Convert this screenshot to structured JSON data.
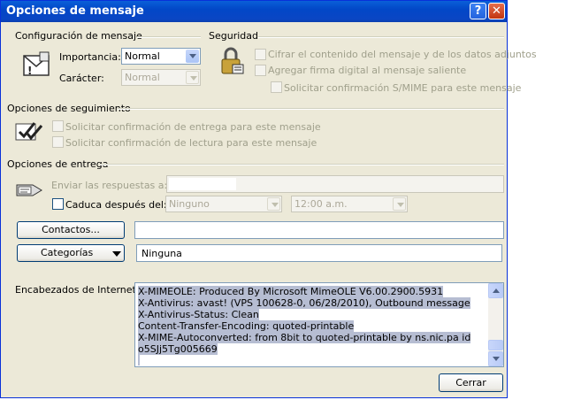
{
  "window": {
    "title": "Opciones de mensaje",
    "help_label": "?",
    "close_label": "✕"
  },
  "config": {
    "section_label": "Configuración de mensaje",
    "importance_label": "Importancia:",
    "importance_value": "Normal",
    "character_label": "Carácter:",
    "character_value": "Normal"
  },
  "security": {
    "section_label": "Seguridad",
    "encrypt_label": "Cifrar el contenido del mensaje y de los datos adjuntos",
    "sign_label": "Agregar firma digital al mensaje saliente",
    "smime_label": "Solicitar confirmación S/MIME para este mensaje"
  },
  "tracking": {
    "section_label": "Opciones de seguimiento",
    "delivery_label": "Solicitar confirmación de entrega para este mensaje",
    "read_label": "Solicitar confirmación de lectura para este mensaje"
  },
  "delivery": {
    "section_label": "Opciones de entrega",
    "reply_to_label": "Enviar las respuestas a:",
    "reply_to_value": "",
    "expires_label": "Caduca después del:",
    "expires_date": "Ninguno",
    "expires_time": "12:00 a.m."
  },
  "contacts": {
    "button_label": "Contactos...",
    "value": ""
  },
  "categories": {
    "button_label": "Categorías",
    "value": "Ninguna"
  },
  "headers": {
    "label": "Encabezados de Internet:",
    "lines": [
      "X-MIMEOLE: Produced By Microsoft MimeOLE V6.00.2900.5931",
      "X-Antivirus: avast! (VPS 100628-0, 06/28/2010), Outbound message",
      "X-Antivirus-Status: Clean",
      "Content-Transfer-Encoding: quoted-printable",
      "X-MIME-Autoconverted: from 8bit to quoted-printable by ns.nic.pa id",
      "o5SJj5Tg005669"
    ]
  },
  "footer": {
    "close_label": "Cerrar"
  }
}
